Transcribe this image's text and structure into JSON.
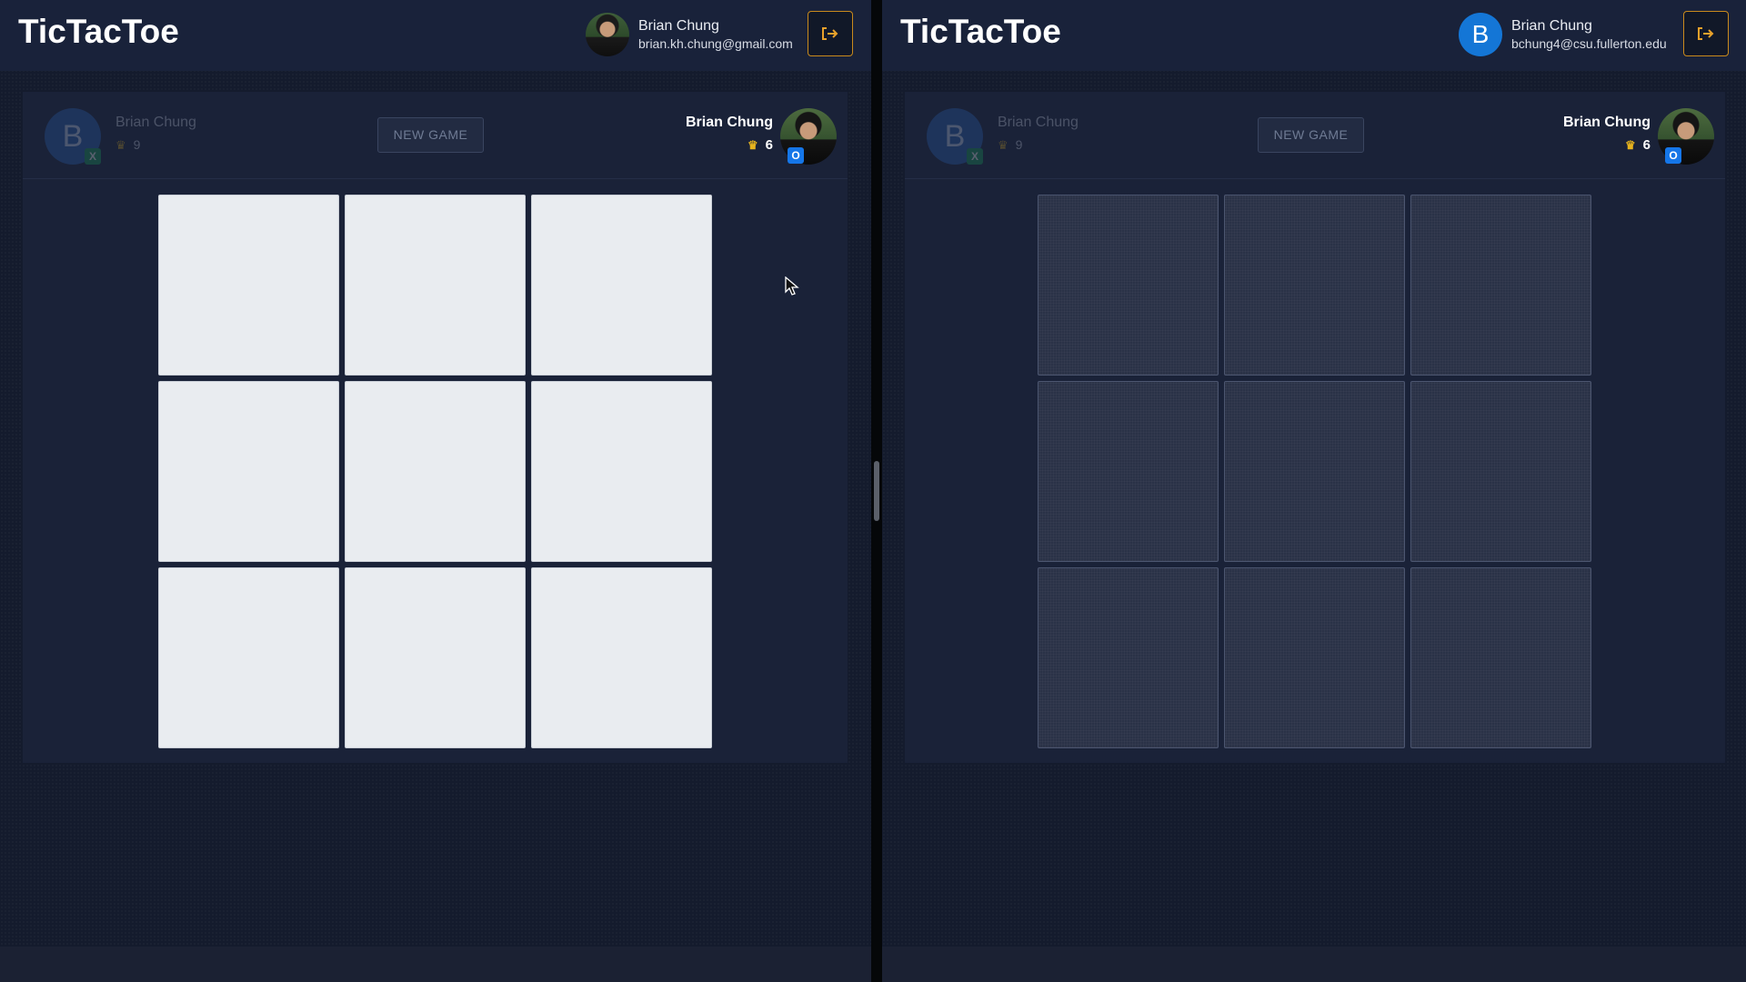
{
  "panes": {
    "left": {
      "app_title": "TicTacToe",
      "user": {
        "name": "Brian Chung",
        "email": "brian.kh.chung@gmail.com",
        "avatar_type": "photo"
      },
      "logout_icon": "logout-icon",
      "player_x": {
        "avatar_letter": "B",
        "name": "Brian Chung",
        "score": "9",
        "mark": "X"
      },
      "new_game_label": "NEW GAME",
      "player_o": {
        "name": "Brian Chung",
        "score": "6",
        "mark": "O"
      },
      "board": {
        "theme": "light",
        "cells": [
          "",
          "",
          "",
          "",
          "",
          "",
          "",
          "",
          ""
        ]
      }
    },
    "right": {
      "app_title": "TicTacToe",
      "user": {
        "name": "Brian Chung",
        "email": "bchung4@csu.fullerton.edu",
        "avatar_type": "letter",
        "avatar_letter": "B"
      },
      "logout_icon": "logout-icon",
      "player_x": {
        "avatar_letter": "B",
        "name": "Brian Chung",
        "score": "9",
        "mark": "X"
      },
      "new_game_label": "NEW GAME",
      "player_o": {
        "name": "Brian Chung",
        "score": "6",
        "mark": "O"
      },
      "board": {
        "theme": "dark",
        "cells": [
          "",
          "",
          "",
          "",
          "",
          "",
          "",
          "",
          ""
        ]
      }
    }
  },
  "colors": {
    "accent_logout": "#e8a12b",
    "x_badge": "#19a05a",
    "o_badge": "#1576e8",
    "avatar_blue": "#1476d6",
    "crown": "#e6b31e"
  }
}
